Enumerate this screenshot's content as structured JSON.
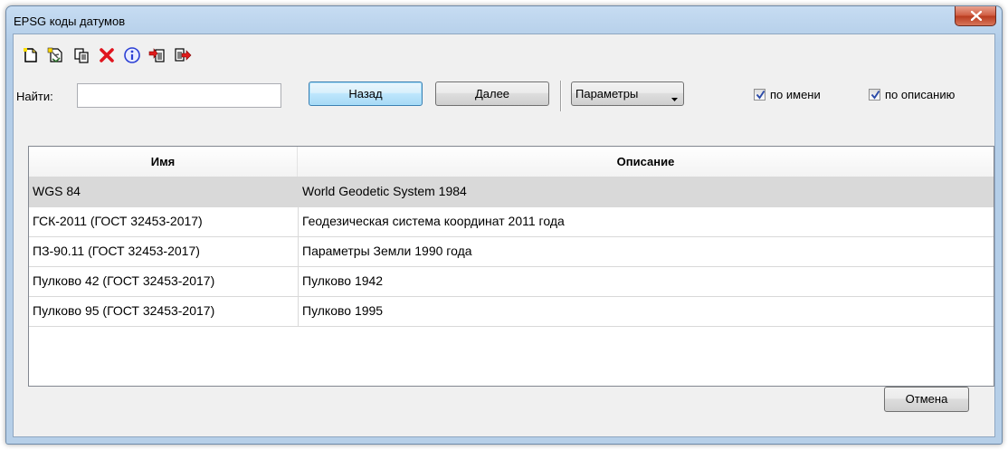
{
  "window": {
    "title": "EPSG коды датумов"
  },
  "toolbar": {
    "buttons": [
      {
        "name": "new-icon"
      },
      {
        "name": "open-icon"
      },
      {
        "name": "copy-icon"
      },
      {
        "name": "delete-icon"
      },
      {
        "name": "info-icon"
      },
      {
        "name": "import-icon"
      },
      {
        "name": "export-icon"
      }
    ]
  },
  "search": {
    "label": "Найти:",
    "value": "",
    "back_label": "Назад",
    "next_label": "Далее",
    "params_label": "Параметры",
    "by_name_label": "по имени",
    "by_name_checked": true,
    "by_desc_label": "по описанию",
    "by_desc_checked": true
  },
  "table": {
    "columns": [
      "Имя",
      "Описание"
    ],
    "rows": [
      {
        "name": "WGS 84",
        "description": "World Geodetic System 1984",
        "selected": true
      },
      {
        "name": "ГСК-2011 (ГОСТ 32453-2017)",
        "description": "Геодезическая система координат 2011 года",
        "selected": false
      },
      {
        "name": "ПЗ-90.11 (ГОСТ 32453-2017)",
        "description": "Параметры Земли 1990 года",
        "selected": false
      },
      {
        "name": "Пулково 42 (ГОСТ 32453-2017)",
        "description": "Пулково 1942",
        "selected": false
      },
      {
        "name": "Пулково 95 (ГОСТ 32453-2017)",
        "description": "Пулково 1995",
        "selected": false
      }
    ]
  },
  "footer": {
    "cancel_label": "Отмена"
  }
}
